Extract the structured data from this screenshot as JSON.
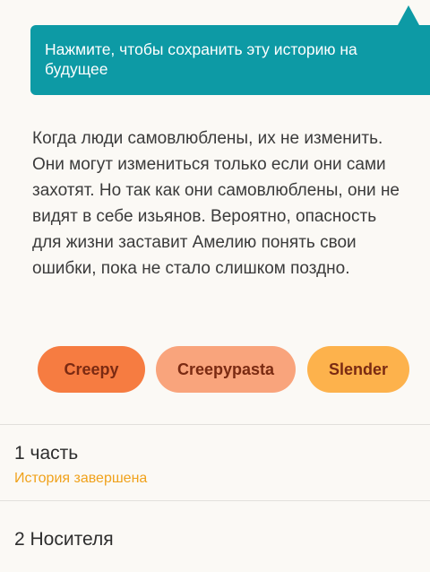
{
  "tooltip": {
    "text": "Нажмите, чтобы сохранить эту историю на будущее"
  },
  "story": {
    "description": "Когда люди самовлюблены, их не изменить. Они могут измениться только если они сами захотят. Но так как они самовлюблены, они не видят в себе изьянов. Вероятно, опасность для жизни заставит Амелию понять свои ошибки, пока не стало слишком поздно."
  },
  "tags": [
    {
      "label": "Creepy",
      "color": "#f67c41"
    },
    {
      "label": "Creepypasta",
      "color": "#f9a47c"
    },
    {
      "label": "Slender",
      "color": "#fdb24c"
    }
  ],
  "parts": [
    {
      "title": "1 часть",
      "status": "История завершена"
    },
    {
      "title": "2 Носителя"
    }
  ],
  "colors": {
    "tooltip_bg": "#0d9aa5",
    "status_text": "#f0a21c",
    "background": "#fbf9f5"
  }
}
